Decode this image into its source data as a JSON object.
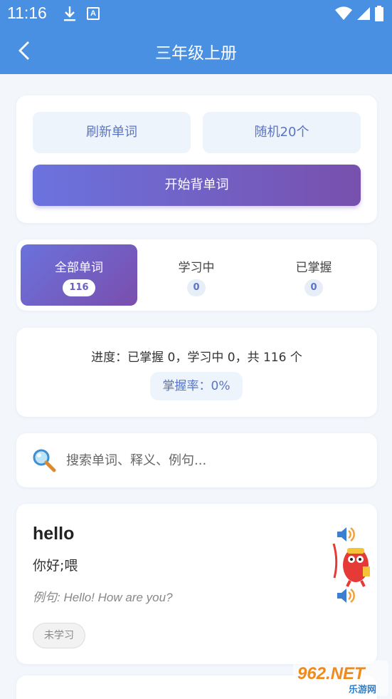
{
  "status_bar": {
    "time": "11:16",
    "icons": [
      "download-icon",
      "a-icon",
      "wifi-icon",
      "signal-icon",
      "battery-icon"
    ]
  },
  "header": {
    "title": "三年级上册",
    "back_icon": "back-icon"
  },
  "actions": {
    "refresh_label": "刷新单词",
    "random_label": "随机20个",
    "start_label": "开始背单词"
  },
  "tabs": [
    {
      "label": "全部单词",
      "count": "116",
      "active": true
    },
    {
      "label": "学习中",
      "count": "0",
      "active": false
    },
    {
      "label": "已掌握",
      "count": "0",
      "active": false
    }
  ],
  "stats": {
    "progress_text": "进度：已掌握 0，学习中 0，共 116 个",
    "rate_text": "掌握率：0%"
  },
  "search": {
    "placeholder": "搜索单词、释义、例句..."
  },
  "words": [
    {
      "word": "hello",
      "meaning": "你好;喂",
      "example": "例句: Hello! How are you?",
      "status": "未学习"
    }
  ],
  "colors": {
    "header": "#4a90e2",
    "accent": "#6a72dc",
    "accent_end": "#7850ad",
    "background": "#f3f6fb"
  },
  "watermark": {
    "text": "962.NET",
    "subtext": "乐游网"
  }
}
